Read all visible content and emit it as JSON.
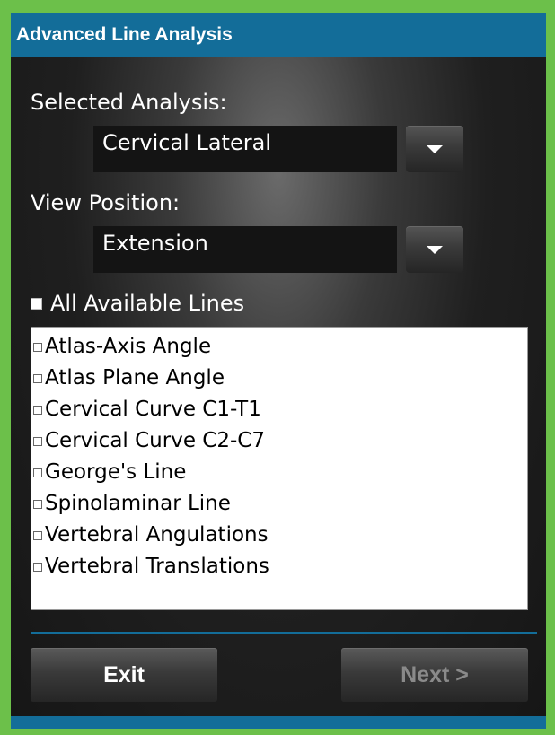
{
  "window": {
    "title": "Advanced Line Analysis"
  },
  "analysis": {
    "label": "Selected Analysis:",
    "selected_value": "Cervical Lateral"
  },
  "view_position": {
    "label": "View Position:",
    "selected_value": "Extension"
  },
  "all_lines": {
    "label": "All Available Lines",
    "checked": false
  },
  "lines": [
    {
      "label": "Atlas-Axis Angle",
      "checked": false
    },
    {
      "label": "Atlas Plane Angle",
      "checked": false
    },
    {
      "label": "Cervical Curve C1-T1",
      "checked": false
    },
    {
      "label": "Cervical Curve C2-C7",
      "checked": false
    },
    {
      "label": "George's Line",
      "checked": false
    },
    {
      "label": "Spinolaminar Line",
      "checked": false
    },
    {
      "label": "Vertebral Angulations",
      "checked": false
    },
    {
      "label": "Vertebral Translations",
      "checked": false
    }
  ],
  "buttons": {
    "exit_label": "Exit",
    "next_label": "Next >",
    "next_enabled": false
  },
  "icons": {
    "dropdown": "chevron-down-icon",
    "checkbox": "checkbox-icon"
  },
  "colors": {
    "accent": "#136d99",
    "frame": "#6cc04a",
    "disabled_text": "#8a8a8a"
  }
}
